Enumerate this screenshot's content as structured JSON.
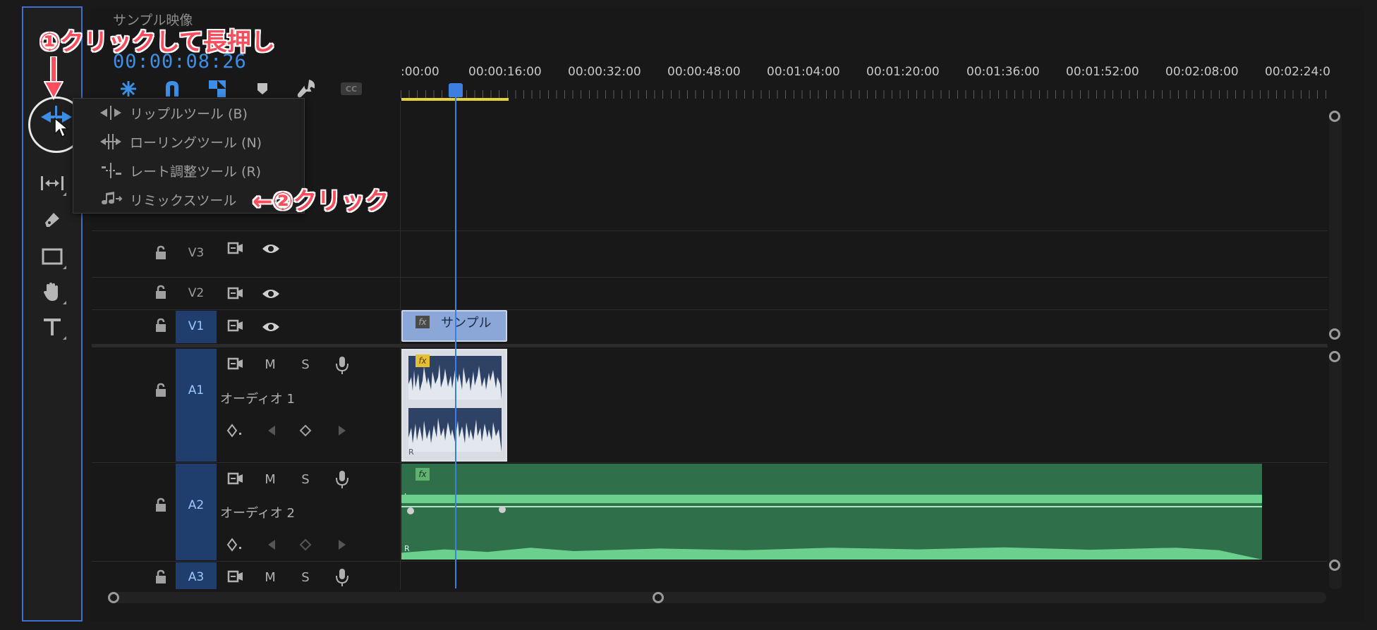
{
  "timeline": {
    "title": "サンプル映像",
    "timecode": "00:00:08:26",
    "ruler_labels": [
      ":00:00",
      "00:00:16:00",
      "00:00:32:00",
      "00:00:48:00",
      "00:01:04:00",
      "00:01:20:00",
      "00:01:36:00",
      "00:01:52:00",
      "00:02:08:00",
      "00:02:24:0"
    ]
  },
  "tool_menu": {
    "items": [
      {
        "label": "リップルツール (B)",
        "icon": "ripple-edit-icon"
      },
      {
        "label": "ローリングツール (N)",
        "icon": "rolling-edit-icon"
      },
      {
        "label": "レート調整ツール (R)",
        "icon": "rate-stretch-icon"
      },
      {
        "label": "リミックスツール",
        "icon": "remix-icon"
      }
    ]
  },
  "tracks": {
    "v3": {
      "label": "V3"
    },
    "v2": {
      "label": "V2"
    },
    "v1": {
      "label": "V1"
    },
    "a1": {
      "label": "A1",
      "name": "オーディオ 1",
      "m": "M",
      "s": "S"
    },
    "a2": {
      "label": "A2",
      "name": "オーディオ 2",
      "m": "M",
      "s": "S"
    },
    "a3": {
      "label": "A3",
      "m": "M",
      "s": "S"
    }
  },
  "clips": {
    "v1_name": "サンプル",
    "fx": "fx",
    "channel_l": "L",
    "channel_r": "R"
  },
  "annotations": {
    "step1": "①クリックして長押し",
    "step2": "←②クリック"
  },
  "colors": {
    "accent": "#3d7fe0",
    "annotation": "#ff4d5e",
    "audio_clip": "#2f6f4a",
    "video_clip": "#8aa7d8",
    "inout": "#e6d23a"
  }
}
